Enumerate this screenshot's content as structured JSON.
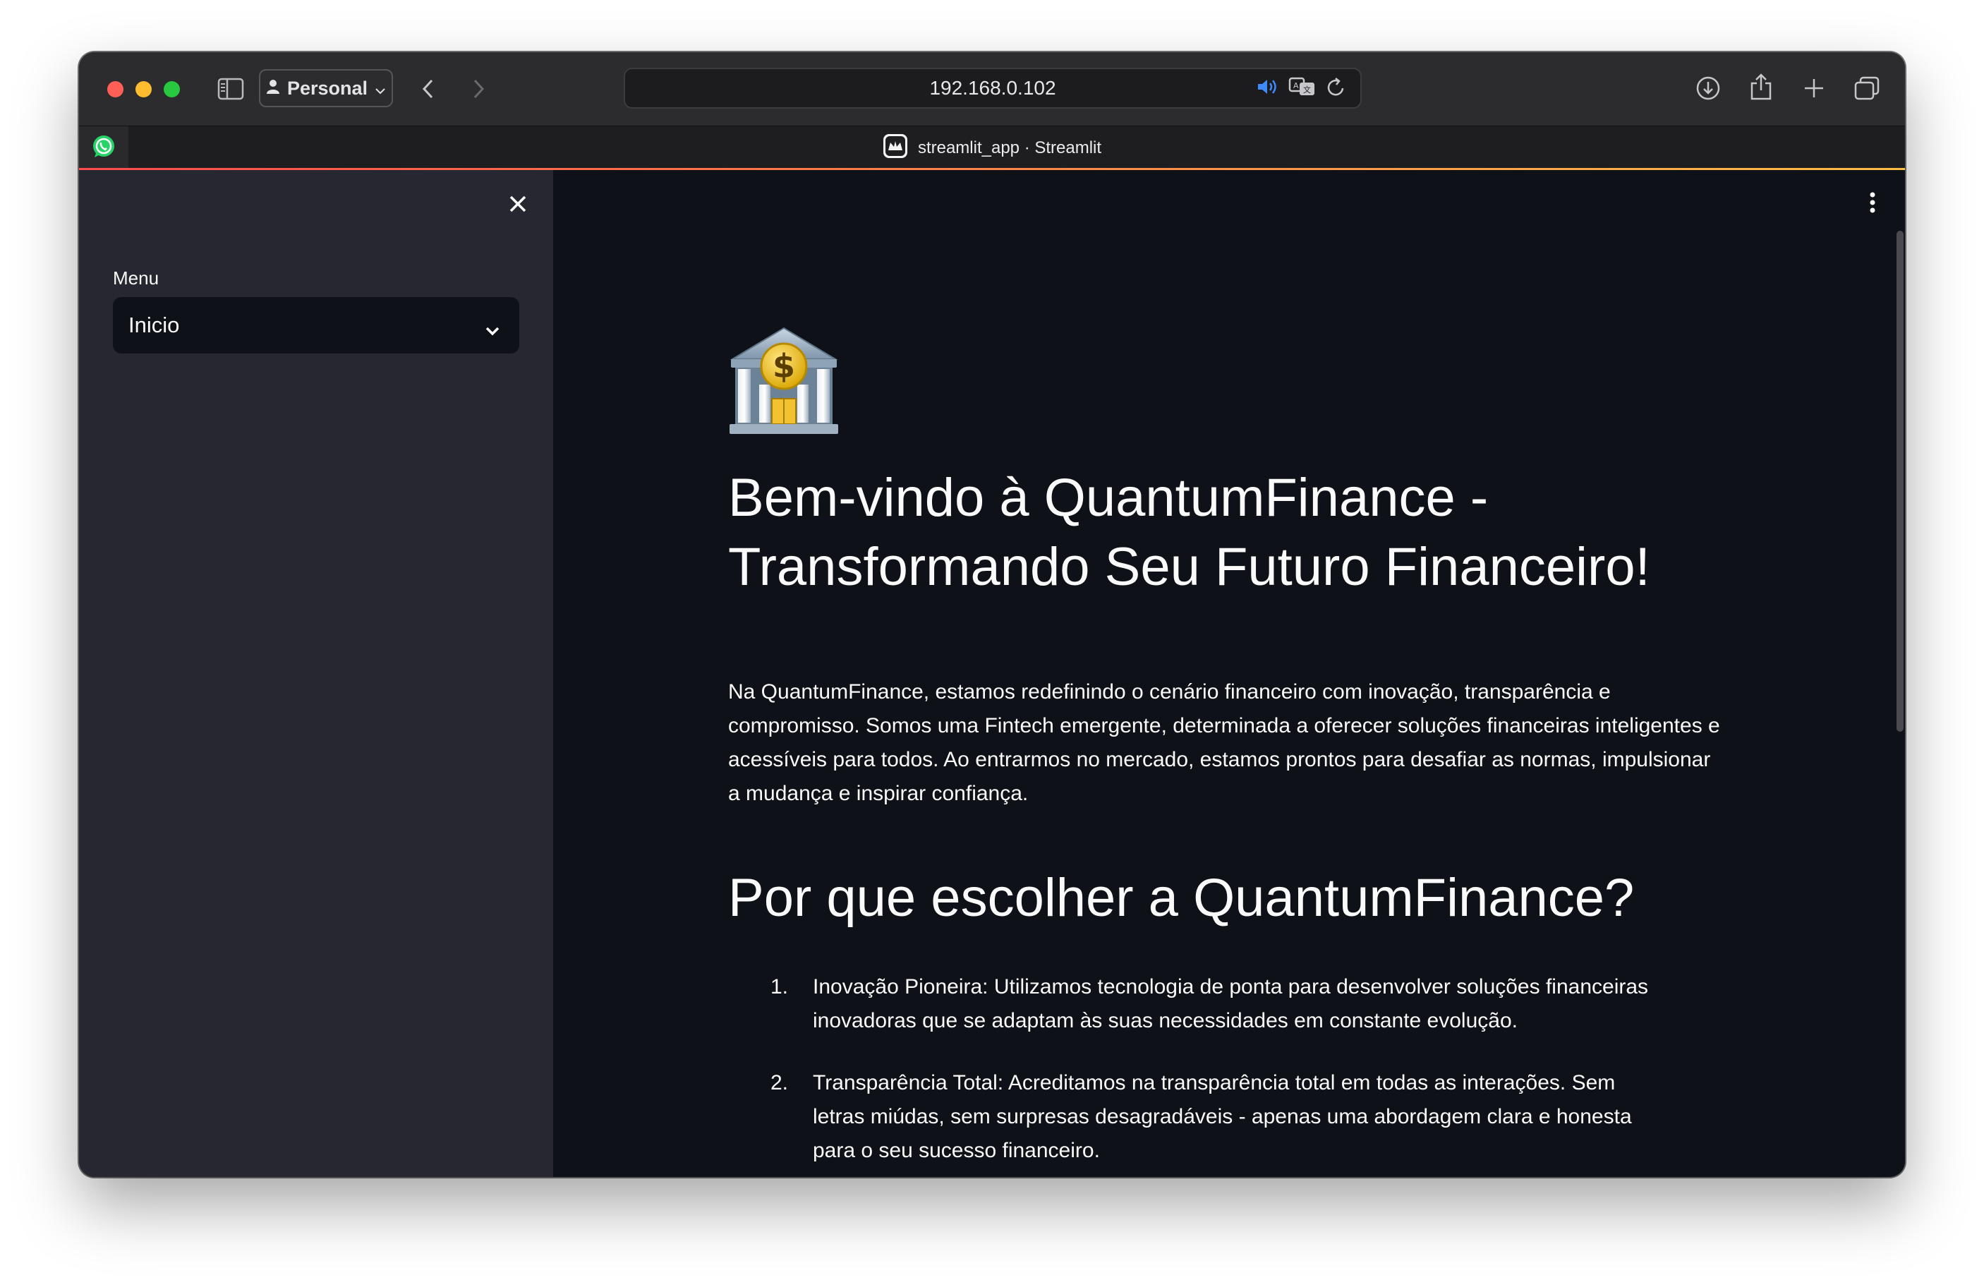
{
  "browser": {
    "profile_label": "Personal",
    "url": "192.168.0.102",
    "tab_title": "streamlit_app · Streamlit"
  },
  "sidebar": {
    "menu_label": "Menu",
    "selected_page": "Inicio"
  },
  "main": {
    "heading": "Bem-vindo à QuantumFinance - Transformando Seu Futuro Financeiro!",
    "intro": "Na QuantumFinance, estamos redefinindo o cenário financeiro com inovação, transparência e compromisso. Somos uma Fintech emergente, determinada a oferecer soluções financeiras inteligentes e acessíveis para todos. Ao entrarmos no mercado, estamos prontos para desafiar as normas, impulsionar a mudança e inspirar confiança.",
    "subheading": "Por que escolher a QuantumFinance?",
    "reasons": [
      {
        "num": "1.",
        "text": "Inovação Pioneira: Utilizamos tecnologia de ponta para desenvolver soluções financeiras inovadoras que se adaptam às suas necessidades em constante evolução."
      },
      {
        "num": "2.",
        "text": "Transparência Total: Acreditamos na transparência total em todas as interações. Sem letras miúdas, sem surpresas desagradáveis - apenas uma abordagem clara e honesta para o seu sucesso financeiro."
      }
    ]
  },
  "colors": {
    "app_bg": "#0e1117",
    "sidebar_bg": "#262730",
    "accent_start": "#ff4b4b",
    "accent_end": "#ffbd45"
  },
  "icons": [
    "sidebar-toggle-icon",
    "person-icon",
    "chevron-down-icon",
    "back-icon",
    "forward-icon",
    "speaker-icon",
    "translate-icon",
    "reload-icon",
    "download-icon",
    "share-icon",
    "new-tab-icon",
    "tabs-overview-icon",
    "whatsapp-icon",
    "streamlit-icon",
    "close-icon",
    "kebab-menu-icon",
    "bank-icon"
  ]
}
